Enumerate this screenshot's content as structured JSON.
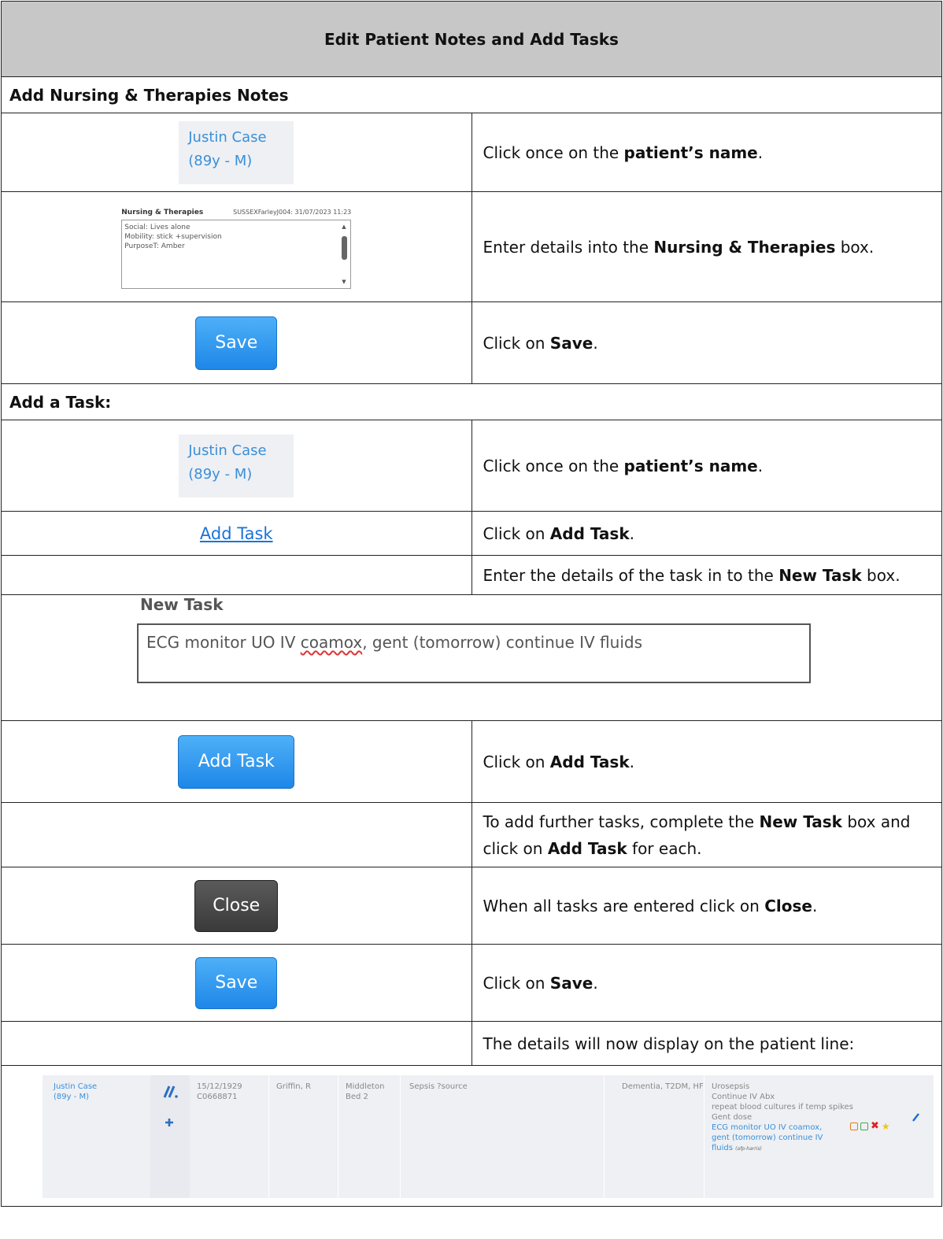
{
  "title": "Edit Patient Notes and Add Tasks",
  "section1": {
    "heading": "Add Nursing & Therapies Notes",
    "patient": {
      "name": "Justin Case",
      "age_sex": "(89y - M)"
    },
    "step1": {
      "pre": "Click once on the ",
      "bold": "patient’s name",
      "post": "."
    },
    "notes_box": {
      "title": "Nursing & Therapies",
      "meta": "SUSSEXFarleyJ004: 31/07/2023 11:23",
      "lines": [
        "Social: Lives alone",
        "Mobility: stick +supervision",
        "PurposeT: Amber"
      ]
    },
    "step2": {
      "pre": "Enter details into the ",
      "bold": "Nursing & Therapies",
      "post": " box."
    },
    "save_button": "Save",
    "step3": {
      "pre": "Click on ",
      "bold": "Save",
      "post": "."
    }
  },
  "section2": {
    "heading": "Add a Task:",
    "patient": {
      "name": "Justin Case",
      "age_sex": "(89y - M)"
    },
    "step1": {
      "pre": "Click once on the ",
      "bold": "patient’s name",
      "post": "."
    },
    "add_task_link": "Add Task",
    "step2": {
      "pre": "Click on ",
      "bold": "Add Task",
      "post": "."
    },
    "step3": {
      "pre": "Enter the details of the task in to the ",
      "bold": "New Task",
      "post": " box."
    },
    "new_task": {
      "label": "New Task",
      "text_a": "ECG monitor UO IV ",
      "text_b": "coamox",
      "text_c": ", gent (tomorrow) continue IV fluids"
    },
    "add_task_button": "Add Task",
    "step4": {
      "pre": "Click on ",
      "bold": "Add Task",
      "post": "."
    },
    "step5": {
      "pre": "To add further tasks, complete the ",
      "bold1": "New Task",
      "mid": " box and click on ",
      "bold2": "Add Task",
      "post": " for each."
    },
    "close_button": "Close",
    "step6": {
      "pre": "When all tasks are entered click on ",
      "bold": "Close",
      "post": "."
    },
    "save_button": "Save",
    "step7": {
      "pre": "Click on ",
      "bold": "Save",
      "post": "."
    },
    "step8": "The details will now display on the patient line:"
  },
  "patient_line": {
    "name": "Justin Case",
    "age_sex": "(89y - M)",
    "dob": "15/12/1929",
    "id": "C0668871",
    "consultant": "Griffin, R",
    "ward": "Middleton",
    "bed": "Bed 2",
    "diagnosis": "Sepsis ?source",
    "pmh": "Dementia, T2DM, HF",
    "plan": [
      "Urosepsis",
      "Continue IV Abx",
      "repeat blood cultures if temp spikes",
      "Gent dose"
    ],
    "task": [
      "ECG monitor UO IV coamox,",
      "gent (tomorrow) continue IV",
      "fluids"
    ],
    "task_author": "(afp-harris)"
  }
}
